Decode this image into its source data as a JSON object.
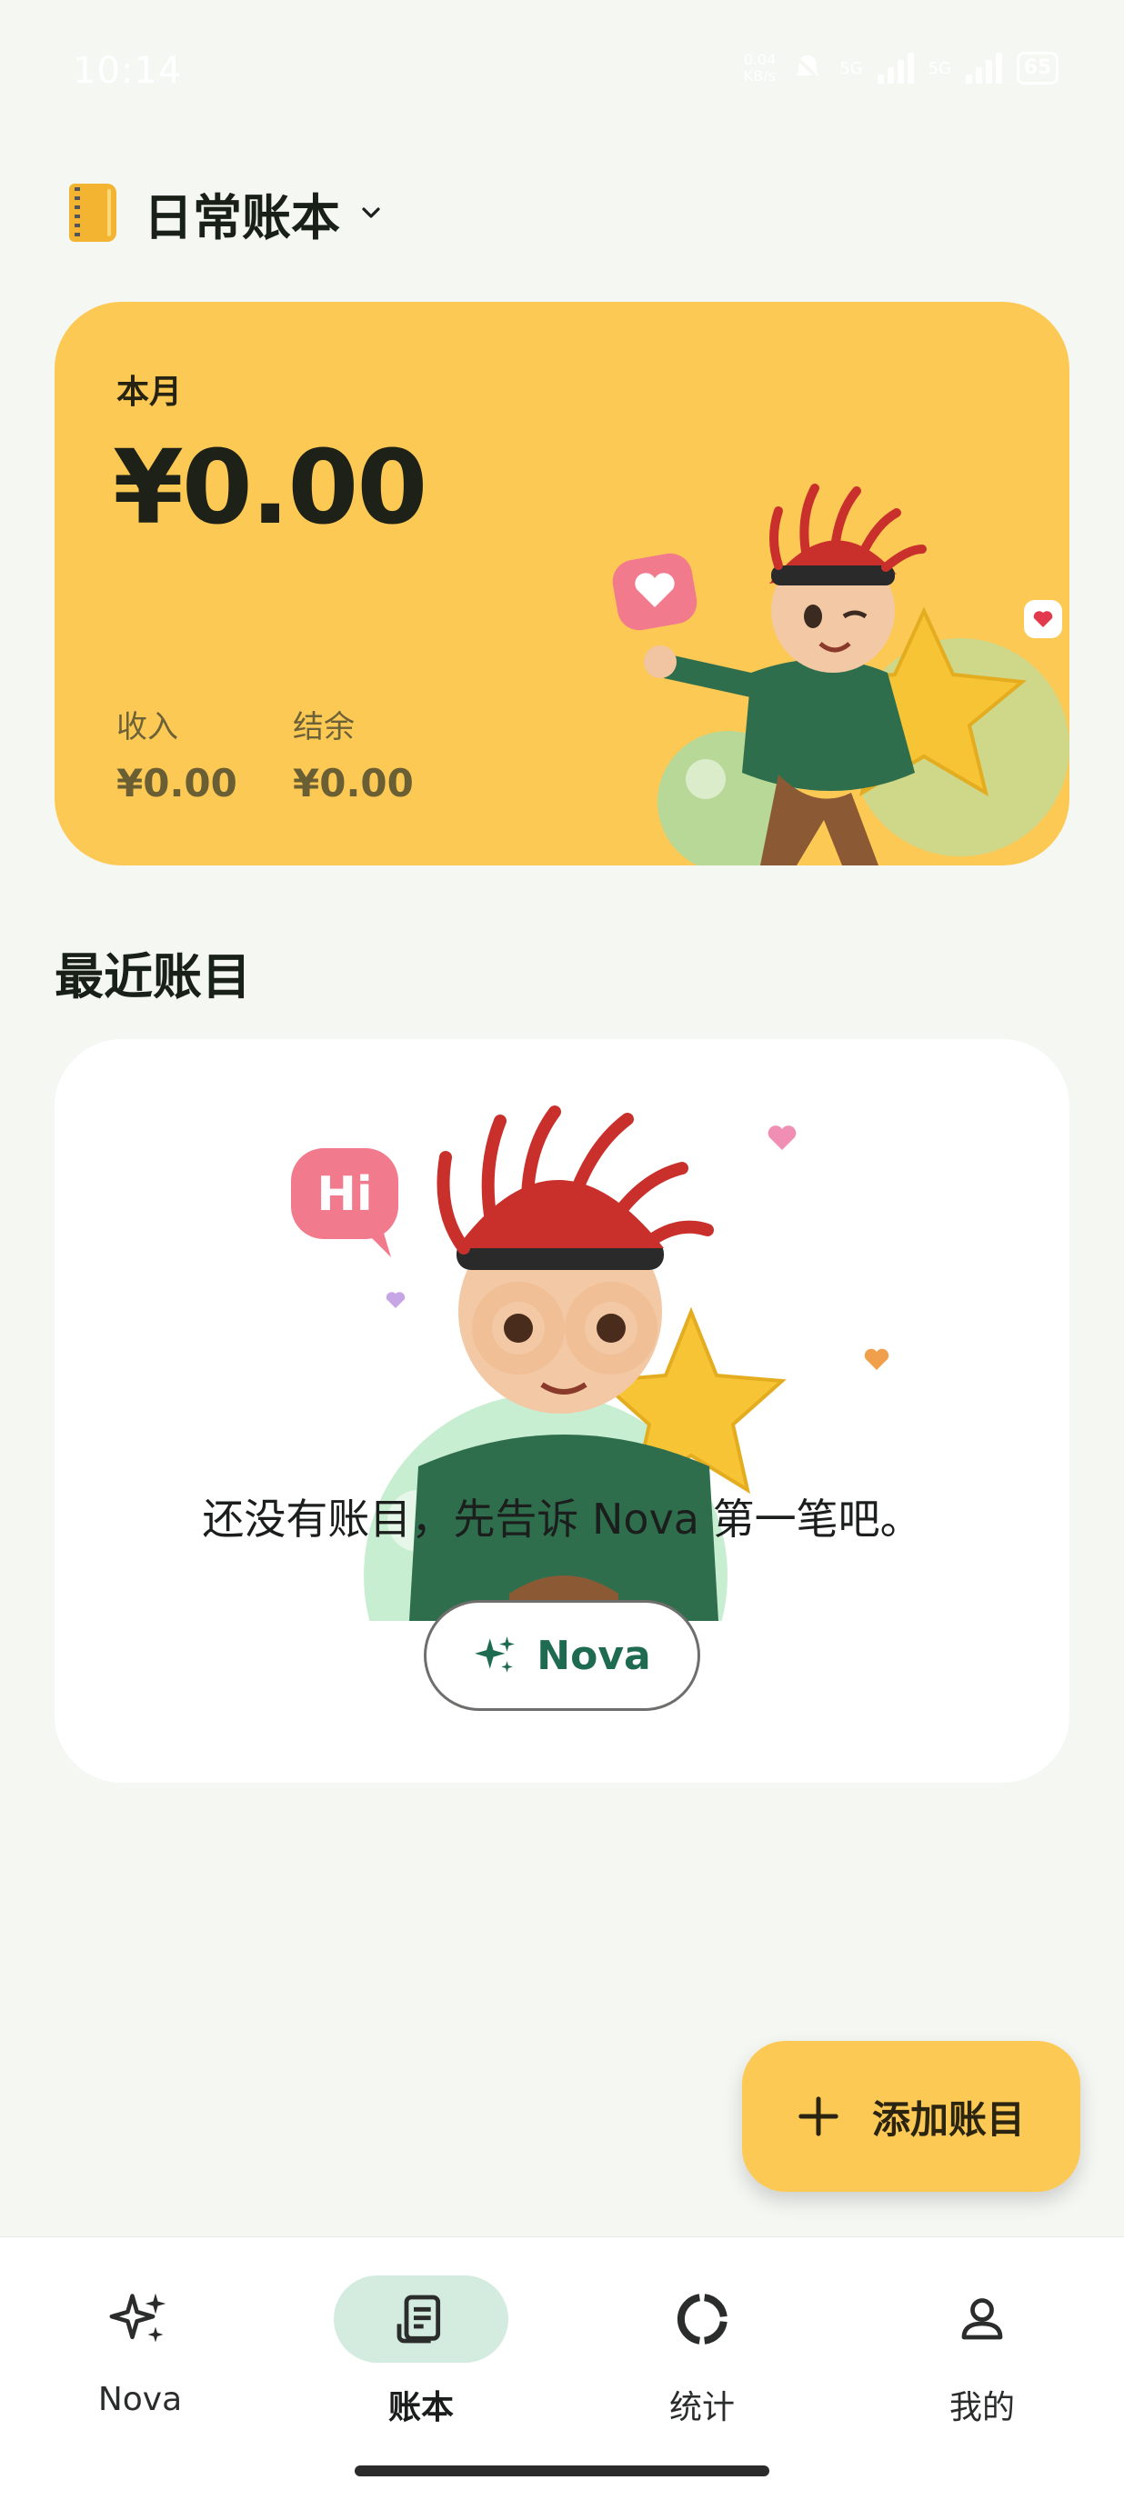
{
  "status_bar": {
    "time": "10:14",
    "net_speed_value": "0.04",
    "net_speed_unit": "KB/s",
    "signal_1_label": "5G",
    "signal_2_label": "5G",
    "battery": "65"
  },
  "header": {
    "book_name": "日常账本",
    "book_icon": "notebook-icon",
    "dropdown_icon": "chevron-down-icon"
  },
  "summary": {
    "period_label": "本月",
    "total": "¥0.00",
    "income_label": "收入",
    "income_value": "¥0.00",
    "balance_label": "结余",
    "balance_value": "¥0.00"
  },
  "recent": {
    "title": "最近账目",
    "empty_message": "还没有账目，先告诉 Nova 第一笔吧。",
    "nova_button_label": "Nova",
    "nova_button_icon": "sparkles-icon",
    "speech_bubble_text": "Hi"
  },
  "fab": {
    "label": "添加账目",
    "icon": "plus-icon"
  },
  "bottom_nav": {
    "items": [
      {
        "label": "Nova",
        "icon": "sparkles-icon",
        "active": false
      },
      {
        "label": "账本",
        "icon": "ledger-icon",
        "active": true
      },
      {
        "label": "统计",
        "icon": "donut-chart-icon",
        "active": false
      },
      {
        "label": "我的",
        "icon": "person-icon",
        "active": false
      }
    ]
  },
  "colors": {
    "background": "#f5f7f3",
    "card_yellow": "#fdc955",
    "accent_green": "#1e6b52",
    "nav_active_bg": "#d4ecdf"
  }
}
